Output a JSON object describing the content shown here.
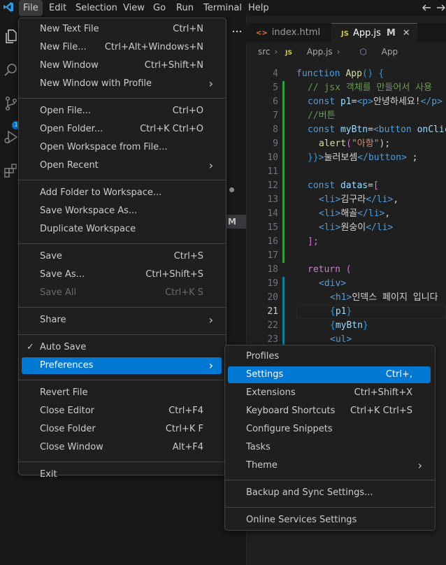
{
  "menubar": {
    "items": [
      "File",
      "Edit",
      "Selection",
      "View",
      "Go",
      "Run",
      "Terminal",
      "Help"
    ]
  },
  "activity": {
    "badge": "1"
  },
  "sidebar": {
    "m_badge": "M"
  },
  "tabs": [
    {
      "label": "index.html",
      "icon": "<>"
    },
    {
      "label": "App.js",
      "icon": "JS",
      "modified": "M",
      "close": "✕"
    }
  ],
  "breadcrumb": {
    "folder": "src",
    "file_icon": "JS",
    "file": "App.js",
    "symbol": "App"
  },
  "code": {
    "current_line": "21",
    "lines": [
      {
        "n": "4"
      },
      {
        "n": "5"
      },
      {
        "n": "6"
      },
      {
        "n": "7"
      },
      {
        "n": "8"
      },
      {
        "n": "9"
      },
      {
        "n": "10"
      },
      {
        "n": "11"
      },
      {
        "n": "12"
      },
      {
        "n": "13"
      },
      {
        "n": "14"
      },
      {
        "n": "15"
      },
      {
        "n": "16"
      },
      {
        "n": "17"
      },
      {
        "n": "18"
      },
      {
        "n": "19"
      },
      {
        "n": "20"
      },
      {
        "n": "21"
      },
      {
        "n": "22"
      },
      {
        "n": "23"
      }
    ],
    "tokens": {
      "l4": [
        "function",
        " ",
        "App",
        "() {"
      ],
      "l5": "// jsx 객체를 만들어서 사용",
      "l6": [
        "const",
        " ",
        "p1",
        "=",
        "<p>",
        "안녕하세요!",
        "</p>"
      ],
      "l7": "//버튼",
      "l8": [
        "const",
        " ",
        "myBtn",
        "=",
        "<button",
        " ",
        "onClick"
      ],
      "l9": [
        "alert",
        "(",
        "\"아항\"",
        ");"
      ],
      "l10": [
        "}}",
        ">",
        "눌러보셈",
        "</button>",
        " ;"
      ],
      "l12": [
        "const",
        " ",
        "datas",
        "=",
        "["
      ],
      "l13": [
        "<li>",
        "김구라",
        "</li>",
        ","
      ],
      "l14": [
        "<li>",
        "해골",
        "</li>",
        ","
      ],
      "l15": [
        "<li>",
        "원숭이",
        "</li>"
      ],
      "l16": [
        "];"
      ],
      "l18": [
        "return",
        " ("
      ],
      "l19": [
        "<div>"
      ],
      "l20": [
        "<h1>",
        "인덱스 페이지 입니다"
      ],
      "l21": [
        "{",
        "p1",
        "}"
      ],
      "l22": [
        "{",
        "myBtn",
        "}"
      ],
      "l23": [
        "<ul>"
      ]
    }
  },
  "file_menu": {
    "groups": [
      [
        {
          "label": "New Text File",
          "key": "Ctrl+N"
        },
        {
          "label": "New File...",
          "key": "Ctrl+Alt+Windows+N"
        },
        {
          "label": "New Window",
          "key": "Ctrl+Shift+N"
        },
        {
          "label": "New Window with Profile",
          "submenu": true
        }
      ],
      [
        {
          "label": "Open File...",
          "key": "Ctrl+O"
        },
        {
          "label": "Open Folder...",
          "key": "Ctrl+K Ctrl+O"
        },
        {
          "label": "Open Workspace from File..."
        },
        {
          "label": "Open Recent",
          "submenu": true
        }
      ],
      [
        {
          "label": "Add Folder to Workspace..."
        },
        {
          "label": "Save Workspace As..."
        },
        {
          "label": "Duplicate Workspace"
        }
      ],
      [
        {
          "label": "Save",
          "key": "Ctrl+S"
        },
        {
          "label": "Save As...",
          "key": "Ctrl+Shift+S"
        },
        {
          "label": "Save All",
          "key": "Ctrl+K S",
          "disabled": true
        }
      ],
      [
        {
          "label": "Share",
          "submenu": true
        }
      ],
      [
        {
          "label": "Auto Save",
          "checked": true
        },
        {
          "label": "Preferences",
          "submenu": true,
          "selected": true
        }
      ],
      [
        {
          "label": "Revert File"
        },
        {
          "label": "Close Editor",
          "key": "Ctrl+F4"
        },
        {
          "label": "Close Folder",
          "key": "Ctrl+K F"
        },
        {
          "label": "Close Window",
          "key": "Alt+F4"
        }
      ],
      [
        {
          "label": "Exit"
        }
      ]
    ]
  },
  "preferences_menu": {
    "groups": [
      [
        {
          "label": "Profiles"
        },
        {
          "label": "Settings",
          "key": "Ctrl+,",
          "selected": true
        },
        {
          "label": "Extensions",
          "key": "Ctrl+Shift+X"
        },
        {
          "label": "Keyboard Shortcuts",
          "key": "Ctrl+K Ctrl+S"
        },
        {
          "label": "Configure Snippets"
        },
        {
          "label": "Tasks"
        },
        {
          "label": "Theme",
          "submenu": true
        }
      ],
      [
        {
          "label": "Backup and Sync Settings..."
        }
      ],
      [
        {
          "label": "Online Services Settings"
        }
      ]
    ]
  },
  "icons": {
    "arrow": "›",
    "check": "✓",
    "back": "←",
    "forward": "→"
  }
}
